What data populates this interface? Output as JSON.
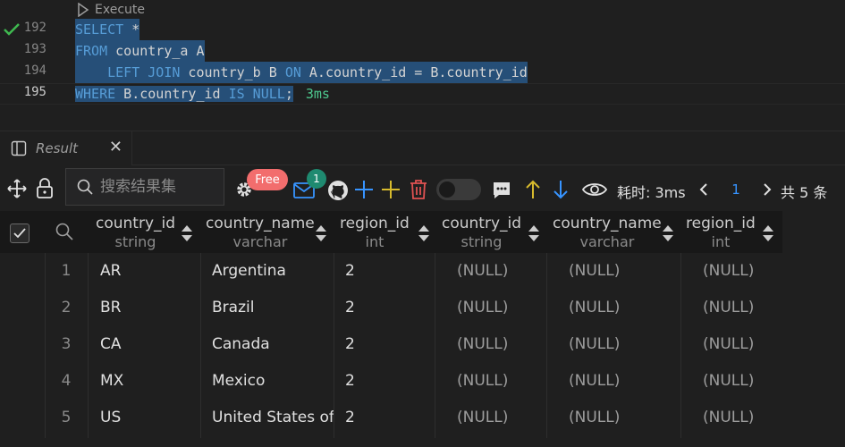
{
  "editor": {
    "codelens": "Execute",
    "lines": [
      {
        "num": "192",
        "tokens": [
          {
            "t": "SELECT",
            "c": "kw"
          },
          {
            "t": " *",
            "c": "id"
          }
        ]
      },
      {
        "num": "193",
        "tokens": [
          {
            "t": "FROM",
            "c": "kw"
          },
          {
            "t": " country_a A",
            "c": "id"
          }
        ]
      },
      {
        "num": "194",
        "tokens": [
          {
            "t": "    ",
            "c": "id"
          },
          {
            "t": "LEFT JOIN",
            "c": "kw"
          },
          {
            "t": " country_b B ",
            "c": "id"
          },
          {
            "t": "ON",
            "c": "kw"
          },
          {
            "t": " A.country_id = B.country_id",
            "c": "id"
          }
        ]
      },
      {
        "num": "195",
        "tokens": [
          {
            "t": "WHERE",
            "c": "kw"
          },
          {
            "t": " B.country_id ",
            "c": "id"
          },
          {
            "t": "IS NULL",
            "c": "kw"
          },
          {
            "t": ";",
            "c": "id"
          }
        ]
      }
    ],
    "timing": "3ms"
  },
  "panel": {
    "tab_label": "Result",
    "search_placeholder": "搜索结果集",
    "free_badge": "Free",
    "notify_count": "1",
    "time_label": "耗时: 3ms",
    "page": "1",
    "total": "共 5 条"
  },
  "table": {
    "columns": [
      {
        "name": "country_id",
        "type": "string"
      },
      {
        "name": "country_name",
        "type": "varchar"
      },
      {
        "name": "region_id",
        "type": "int"
      },
      {
        "name": "country_id",
        "type": "string"
      },
      {
        "name": "country_name",
        "type": "varchar"
      },
      {
        "name": "region_id",
        "type": "int"
      }
    ],
    "rows": [
      {
        "idx": "1",
        "cells": [
          "AR",
          "Argentina",
          "2",
          "(NULL)",
          "(NULL)",
          "(NULL)"
        ]
      },
      {
        "idx": "2",
        "cells": [
          "BR",
          "Brazil",
          "2",
          "(NULL)",
          "(NULL)",
          "(NULL)"
        ]
      },
      {
        "idx": "3",
        "cells": [
          "CA",
          "Canada",
          "2",
          "(NULL)",
          "(NULL)",
          "(NULL)"
        ]
      },
      {
        "idx": "4",
        "cells": [
          "MX",
          "Mexico",
          "2",
          "(NULL)",
          "(NULL)",
          "(NULL)"
        ]
      },
      {
        "idx": "5",
        "cells": [
          "US",
          "United States of America",
          "2",
          "(NULL)",
          "(NULL)",
          "(NULL)"
        ]
      }
    ]
  },
  "colors": {
    "keyword": "#569cd6",
    "selection": "#264f78",
    "timing": "#4ec98f",
    "free_badge": "#f26d6d",
    "count_badge": "#1f8a70",
    "accent_blue": "#3794ff"
  }
}
